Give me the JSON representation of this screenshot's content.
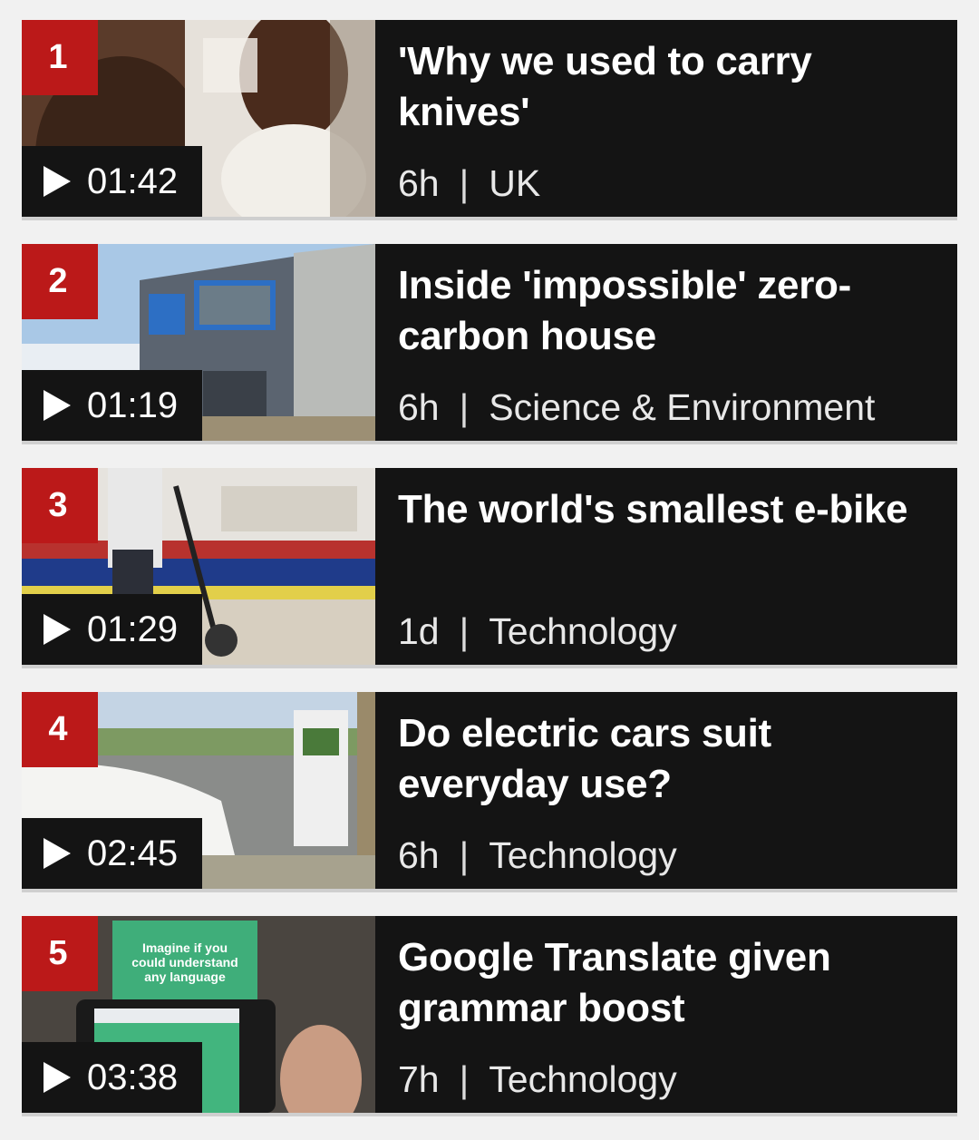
{
  "videos": [
    {
      "rank": "1",
      "duration": "01:42",
      "headline": "'Why we used to carry knives'",
      "age": "6h",
      "section": "UK"
    },
    {
      "rank": "2",
      "duration": "01:19",
      "headline": "Inside 'impossible' zero-carbon house",
      "age": "6h",
      "section": "Science & Environment"
    },
    {
      "rank": "3",
      "duration": "01:29",
      "headline": "The world's smallest e-bike",
      "age": "1d",
      "section": "Technology"
    },
    {
      "rank": "4",
      "duration": "02:45",
      "headline": "Do electric cars suit everyday use?",
      "age": "6h",
      "section": "Technology"
    },
    {
      "rank": "5",
      "duration": "03:38",
      "headline": "Google Translate given grammar boost",
      "age": "7h",
      "section": "Technology"
    }
  ],
  "separator": "|",
  "thumb5_sign": [
    "Imagine if you",
    "could understand",
    "any language"
  ],
  "colors": {
    "rank_badge": "#bb1919",
    "card_bg": "#141414",
    "page_bg": "#f1f1f1"
  }
}
